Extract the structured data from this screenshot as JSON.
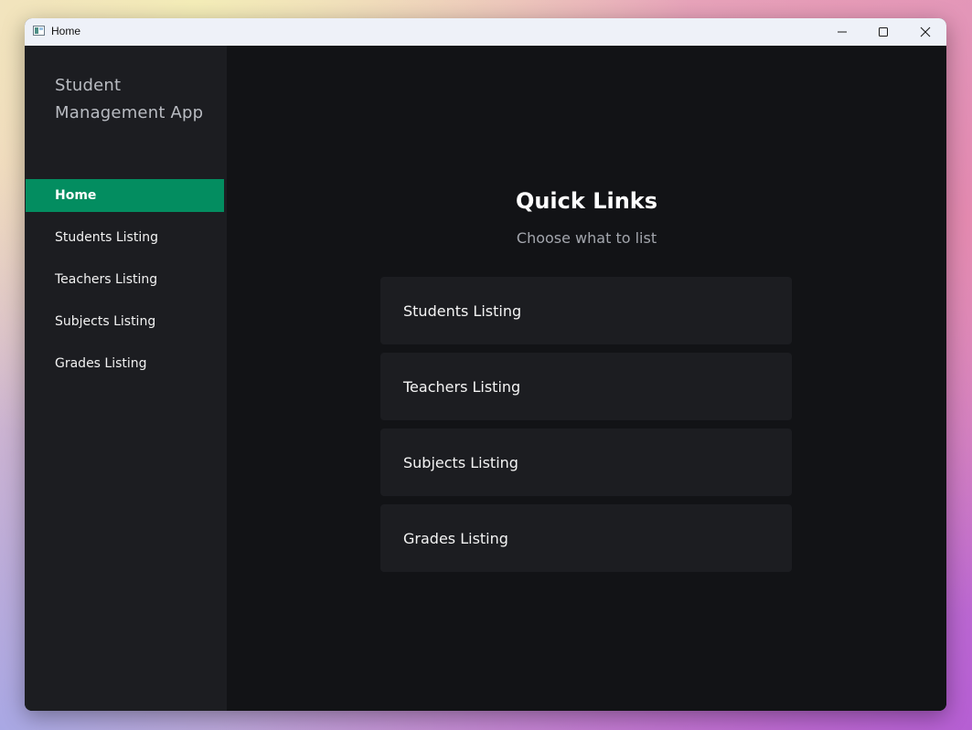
{
  "window": {
    "title": "Home"
  },
  "sidebar": {
    "app_name": "Student Management App",
    "items": [
      {
        "label": "Home",
        "active": true
      },
      {
        "label": "Students Listing",
        "active": false
      },
      {
        "label": "Teachers Listing",
        "active": false
      },
      {
        "label": "Subjects Listing",
        "active": false
      },
      {
        "label": "Grades Listing",
        "active": false
      }
    ]
  },
  "main": {
    "heading": "Quick Links",
    "subheading": "Choose what to list",
    "cards": [
      {
        "label": "Students Listing"
      },
      {
        "label": "Teachers Listing"
      },
      {
        "label": "Subjects Listing"
      },
      {
        "label": "Grades Listing"
      }
    ]
  },
  "colors": {
    "accent": "#038d60",
    "sidebar_bg": "#1c1d21",
    "main_bg": "#121316",
    "card_bg": "#1c1d21"
  },
  "icons": {
    "app": "app-window-icon",
    "minimize": "minimize-icon",
    "maximize": "maximize-icon",
    "close": "close-icon"
  }
}
